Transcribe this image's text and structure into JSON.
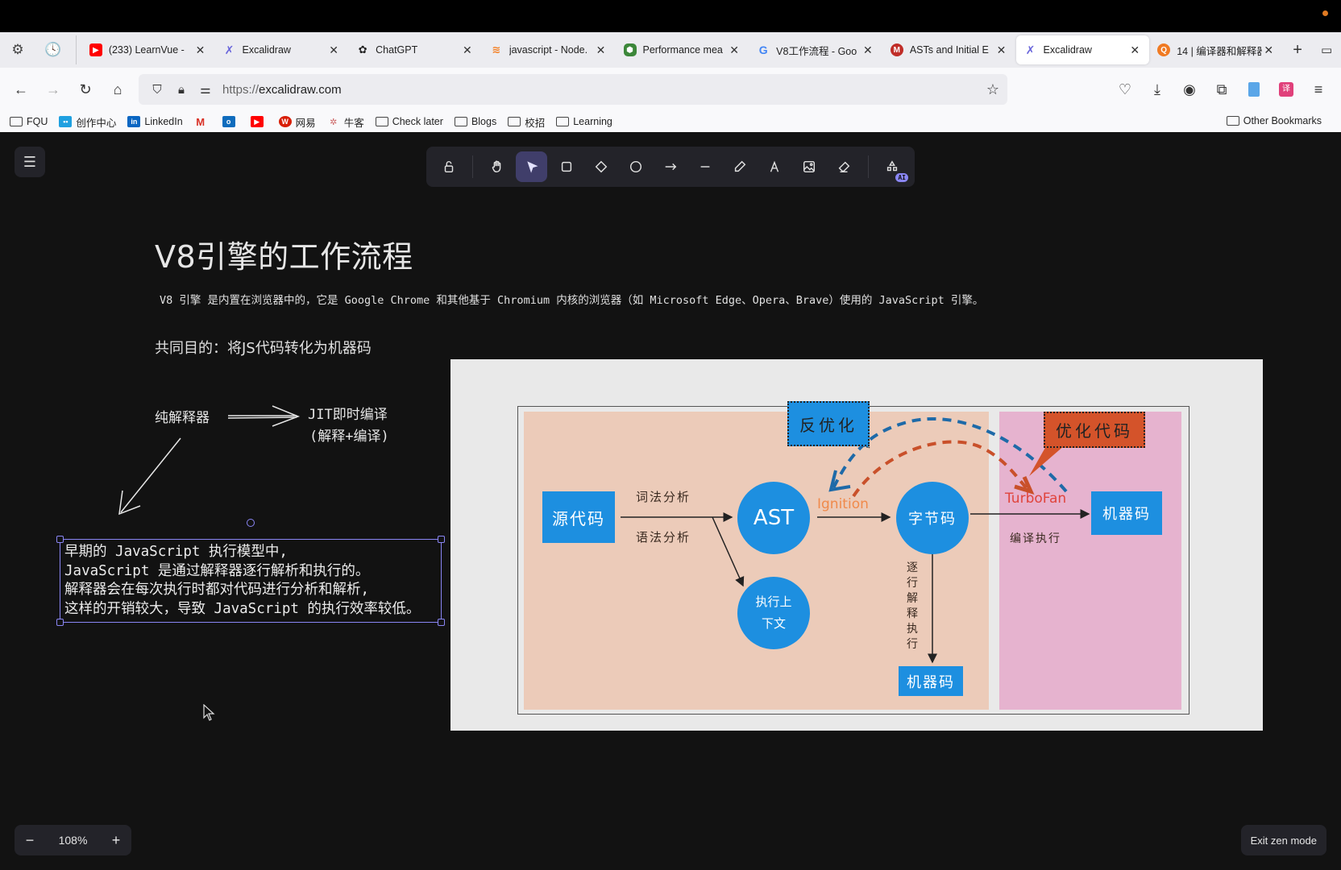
{
  "browser": {
    "tabs": [
      {
        "label": "(233) LearnVue -",
        "favicon": "youtube-icon",
        "color": "#ff0000",
        "active": false
      },
      {
        "label": "Excalidraw",
        "favicon": "excalidraw-icon",
        "color": "#6965db",
        "active": false
      },
      {
        "label": "ChatGPT",
        "favicon": "chatgpt-icon",
        "color": "#222222",
        "active": false
      },
      {
        "label": "javascript - Node.",
        "favicon": "stackoverflow-icon",
        "color": "#f48024",
        "active": false
      },
      {
        "label": "Performance mea",
        "favicon": "nodejs-icon",
        "color": "#3c873a",
        "active": false
      },
      {
        "label": "V8工作流程 - Goo",
        "favicon": "google-icon",
        "color": "#4285f4",
        "active": false
      },
      {
        "label": "ASTs and Initial E",
        "favicon": "frontend-masters-icon",
        "color": "#c02d28",
        "active": false
      },
      {
        "label": "Excalidraw",
        "favicon": "excalidraw-icon",
        "color": "#6965db",
        "active": true
      },
      {
        "label": "14 | 编译器和解释器",
        "favicon": "geektime-icon",
        "color": "#f07a22",
        "active": false
      }
    ],
    "url_scheme": "https://",
    "url_host": "excalidraw.com",
    "bookmarks": [
      {
        "label": "FQU",
        "icon": "folder-icon"
      },
      {
        "label": "创作中心",
        "icon": "bilibili-icon"
      },
      {
        "label": "LinkedIn",
        "icon": "linkedin-icon"
      },
      {
        "label": "",
        "icon": "gmail-icon"
      },
      {
        "label": "",
        "icon": "outlook-icon"
      },
      {
        "label": "",
        "icon": "youtube-icon"
      },
      {
        "label": "网易",
        "icon": "netease-icon"
      },
      {
        "label": "牛客",
        "icon": "nowcoder-icon"
      },
      {
        "label": "Check later",
        "icon": "folder-icon"
      },
      {
        "label": "Blogs",
        "icon": "folder-icon"
      },
      {
        "label": "校招",
        "icon": "folder-icon"
      },
      {
        "label": "Learning",
        "icon": "folder-icon"
      }
    ],
    "other_bookmarks": "Other Bookmarks"
  },
  "excalidraw": {
    "tools": [
      "lock",
      "hand",
      "selection",
      "rectangle",
      "diamond",
      "ellipse",
      "arrow",
      "line",
      "draw",
      "text",
      "image",
      "eraser",
      "ai-tools"
    ],
    "active_tool": "selection",
    "ai_badge": "AI",
    "zoom_level": "108%",
    "zoom_out": "−",
    "zoom_in": "+",
    "exit_zen": "Exit zen mode"
  },
  "canvas": {
    "title": "V8引擎的工作流程",
    "subtitle": "V8 引擎 是内置在浏览器中的，它是 Google Chrome 和其他基于 Chromium 内核的浏览器（如 Microsoft Edge、Opera、Brave）使用的 JavaScript 引擎。",
    "goal": "共同目的：将JS代码转化为机器码",
    "pure_interpreter": "纯解释器",
    "jit_line1": "JIT即时编译",
    "jit_line2": "(解释+编译)",
    "selected_text": [
      "早期的 JavaScript 执行模型中,",
      "JavaScript 是通过解释器逐行解析和执行的。",
      "解释器会在每次执行时都对代码进行分析和解析,",
      "这样的开销较大，导致 JavaScript 的执行效率较低。"
    ]
  },
  "diagram": {
    "source_code": "源代码",
    "lexical": "词法分析",
    "syntax": "语法分析",
    "ast": "AST",
    "exec_context_1": "执行上",
    "exec_context_2": "下文",
    "ignition": "Ignition",
    "bytecode": "字节码",
    "line_by_line": [
      "逐",
      "行",
      "解",
      "释",
      "执",
      "行"
    ],
    "machine_code_bottom": "机器码",
    "turbofan": "TurboFan",
    "machine_code_right": "机器码",
    "compile_exec": "编译执行",
    "deopt": "反优化",
    "optimize": "优化代码",
    "colors": {
      "blue": "#1d8fe0",
      "ignition_zone": "#eccbb9",
      "turbofan_zone": "#e6b3cf",
      "deopt_arrow": "#1e6aa8",
      "opt_arrow": "#c9502a",
      "opt_callout": "#d4532a"
    }
  }
}
